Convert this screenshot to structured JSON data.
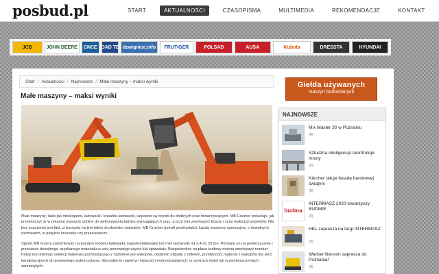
{
  "header": {
    "logo": "posbud.pl",
    "nav": [
      {
        "label": "START",
        "active": false
      },
      {
        "label": "AKTUALNOŚCI",
        "active": true
      },
      {
        "label": "CZASOPISMA",
        "active": false
      },
      {
        "label": "MULTIMEDIA",
        "active": false
      },
      {
        "label": "REKOMENDACJE",
        "active": false
      },
      {
        "label": "KONTAKT",
        "active": false
      }
    ]
  },
  "partners": [
    {
      "label": "JCB",
      "color": "#1a1a1a",
      "bg": "#f2b700"
    },
    {
      "label": "JOHN DEERE",
      "color": "#1f5a1f",
      "bg": "#ffffff"
    },
    {
      "label": "CNCE",
      "color": "#ffffff",
      "bg": "#1d5d9b"
    },
    {
      "label": "ROAD TEC",
      "color": "#ffffff",
      "bg": "#224a86"
    },
    {
      "label": "dzwignice.info",
      "color": "#ffffff",
      "bg": "#3a6fb0"
    },
    {
      "label": "FRUTIGER",
      "color": "#1a4fa0",
      "bg": "#ffffff"
    },
    {
      "label": "POLSAD",
      "color": "#ffffff",
      "bg": "#c8202a"
    },
    {
      "label": "AUSA",
      "color": "#ffffff",
      "bg": "#c8202a"
    },
    {
      "label": "Kubota",
      "color": "#e05a00",
      "bg": "#ffffff"
    },
    {
      "label": "DRESSTA",
      "color": "#ffffff",
      "bg": "#333333"
    },
    {
      "label": "HYUNDAI",
      "color": "#ffffff",
      "bg": "#222222"
    }
  ],
  "breadcrumb": [
    "Start",
    "Aktualności",
    "Najnowsze",
    "Małe maszyny – maksi wyniki"
  ],
  "article": {
    "title": "Małe maszyny – maksi wyniki",
    "paragraphs": [
      "Małe maszyny, takie jak minikoparki, ładowarki i koparko-ładowarki, używane są często do drobnych prac towarzyszących. MB Crusher pokazuje, jak przeistoczyć je w potężne maszyny zdolne do wykonywania bardzo wymagających prac, a przy tym zmniejszyć koszty i czas realizacji projektów. Nie bez znaczenia jest fakt, iż korzysta na tym także środowisko naturalne. MB Crusher potrafi przekształcić każdą maszynę operacyjną, o dowolnych rozmiarach, w potężne kruszarki czy przesiewacze.",
      "Sprzęt MB można zamontować na każdym modelu ładowarki, koparko-ładowarki lub mini ładowarki od 2,4 do 25 ton. Pozwala on na przekruszanie i przesianie dowolnego uzyskanego materiału w celu ponownego użycia lub sprzedaży. Bezpośrednio na placu budowy można zmniejszyć rozmiar frakcji lub dokonać selekcji materiału pochodzącego z rozbiórek lub wykopów, oddzielić odpady z odlewni, przetworzyć materiał z wykopów dla sieci kanalizacyjnych do ponownego wykorzystania. Wszystko to nawet w miejscach trudnodostępnych, w centrach miast lub w pomieszczeniach zamkniętych."
    ]
  },
  "sidebar": {
    "banner_main": "Giełda używanych",
    "banner_sub": "maszyn budowlanych",
    "news_heading": "NAJNOWSZE",
    "news": [
      {
        "title": "Mix Master 30 w Poznaniu",
        "comments": "(0)"
      },
      {
        "title": "Sztuczna inteligencja skontroluje mosty",
        "comments": "(0)"
      },
      {
        "title": "Kärcher ratuje fasadę barokowej świątyni",
        "comments": "(0)"
      },
      {
        "title": "INTERMASZ 2020 towarzyszy BUDMIE",
        "comments": "(0)"
      },
      {
        "title": "HKL zaprasza na targi INTERMASZ",
        "comments": "(0)"
      },
      {
        "title": "Wacker Neuson zaprasza do Poznania!",
        "comments": "(0)"
      }
    ],
    "thumb_texts": {
      "budma": "budma"
    }
  },
  "colors": {
    "accent": "#c8581c",
    "nav_active": "#3a3a3a"
  }
}
